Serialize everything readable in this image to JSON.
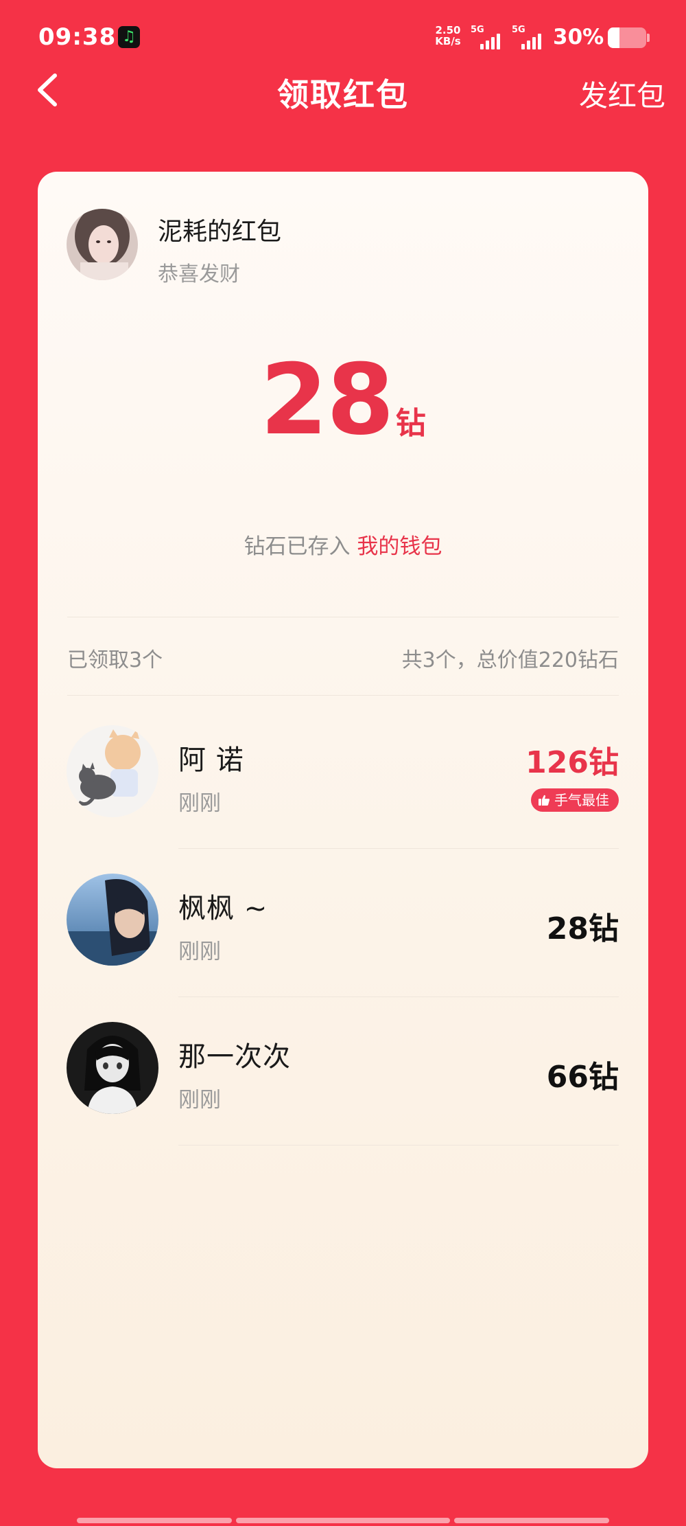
{
  "status_bar": {
    "time": "09:38",
    "app_badge_icon": "music-app-icon",
    "net_speed_value": "2.50",
    "net_speed_unit": "KB/s",
    "signal1_label": "5G",
    "signal2_label": "5G",
    "battery_text": "30%",
    "battery_level": 0.3
  },
  "header": {
    "title": "领取红包",
    "send_label": "发红包"
  },
  "sender": {
    "name": "泥耗的红包",
    "greeting": "恭喜发财"
  },
  "amount": {
    "value": "28",
    "unit": "钻"
  },
  "wallet_note": {
    "prefix": "钻石已存入",
    "link": "我的钱包"
  },
  "summary": {
    "claimed": "已领取3个",
    "total": "共3个，总价值220钻石"
  },
  "recipients": [
    {
      "name": "阿 诺",
      "time": "刚刚",
      "amount": "126钻",
      "badge": "手气最佳"
    },
    {
      "name": "枫枫 ~",
      "time": "刚刚",
      "amount": "28钻"
    },
    {
      "name": "那一次次",
      "time": "刚刚",
      "amount": "66钻"
    }
  ],
  "colors": {
    "background": "#f53247",
    "accent": "#e8344a",
    "card": "#fdf5ec"
  }
}
